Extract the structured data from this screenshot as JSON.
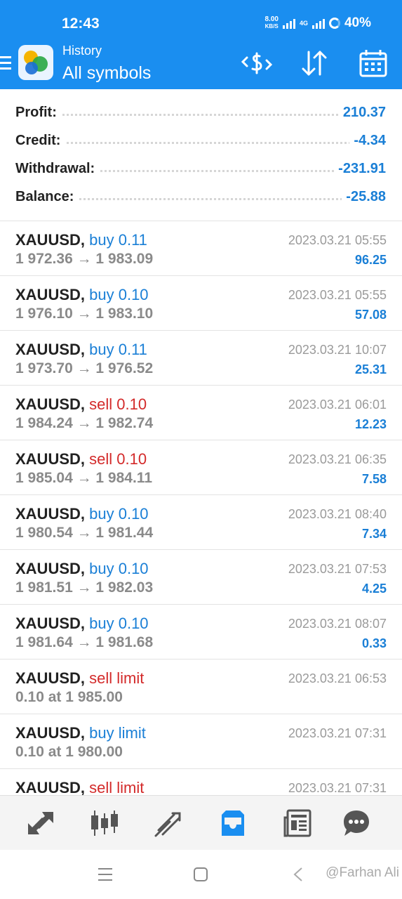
{
  "status_bar": {
    "time": "12:43",
    "net_speed_value": "8.00",
    "net_speed_unit": "KB/S",
    "network_type": "4G",
    "battery": "40%"
  },
  "app_bar": {
    "subtitle": "History",
    "title": "All symbols",
    "icons": [
      "deposit-withdraw-icon",
      "sort-icon",
      "calendar-icon"
    ]
  },
  "summary": [
    {
      "label": "Profit:",
      "value": "210.37"
    },
    {
      "label": "Credit:",
      "value": "-4.34"
    },
    {
      "label": "Withdrawal:",
      "value": "-231.91"
    },
    {
      "label": "Balance:",
      "value": "-25.88"
    }
  ],
  "deals": [
    {
      "symbol": "XAUUSD,",
      "side": "buy 0.11",
      "type": "buy",
      "prices": "1 972.36 → 1 983.09",
      "time": "2023.03.21 05:55",
      "profit": "96.25"
    },
    {
      "symbol": "XAUUSD,",
      "side": "buy 0.10",
      "type": "buy",
      "prices": "1 976.10 → 1 983.10",
      "time": "2023.03.21 05:55",
      "profit": "57.08"
    },
    {
      "symbol": "XAUUSD,",
      "side": "buy 0.11",
      "type": "buy",
      "prices": "1 973.70 → 1 976.52",
      "time": "2023.03.21 10:07",
      "profit": "25.31"
    },
    {
      "symbol": "XAUUSD,",
      "side": "sell 0.10",
      "type": "sell",
      "prices": "1 984.24 → 1 982.74",
      "time": "2023.03.21 06:01",
      "profit": "12.23"
    },
    {
      "symbol": "XAUUSD,",
      "side": "sell 0.10",
      "type": "sell",
      "prices": "1 985.04 → 1 984.11",
      "time": "2023.03.21 06:35",
      "profit": "7.58"
    },
    {
      "symbol": "XAUUSD,",
      "side": "buy 0.10",
      "type": "buy",
      "prices": "1 980.54 → 1 981.44",
      "time": "2023.03.21 08:40",
      "profit": "7.34"
    },
    {
      "symbol": "XAUUSD,",
      "side": "buy 0.10",
      "type": "buy",
      "prices": "1 981.51 → 1 982.03",
      "time": "2023.03.21 07:53",
      "profit": "4.25"
    },
    {
      "symbol": "XAUUSD,",
      "side": "buy 0.10",
      "type": "buy",
      "prices": "1 981.64 → 1 981.68",
      "time": "2023.03.21 08:07",
      "profit": "0.33"
    },
    {
      "symbol": "XAUUSD,",
      "side": "sell limit",
      "type": "sell",
      "prices": "0.10 at 1 985.00",
      "time": "2023.03.21 06:53",
      "profit": ""
    },
    {
      "symbol": "XAUUSD,",
      "side": "buy limit",
      "type": "buy",
      "prices": "0.10 at 1 980.00",
      "time": "2023.03.21 07:31",
      "profit": ""
    },
    {
      "symbol": "XAUUSD,",
      "side": "sell limit",
      "type": "sell",
      "prices": "",
      "time": "2023.03.21 07:31",
      "profit": ""
    }
  ],
  "bottom_nav": {
    "items": [
      "quotes-icon",
      "chart-icon",
      "trade-icon",
      "history-icon",
      "news-icon",
      "chat-icon"
    ],
    "active": "history-icon",
    "active_color": "#1a8ef0"
  },
  "watermark": "@Farhan Ali",
  "colors": {
    "accent": "#1a8ef0",
    "buy": "#1a7fd6",
    "sell": "#d32a2a"
  }
}
